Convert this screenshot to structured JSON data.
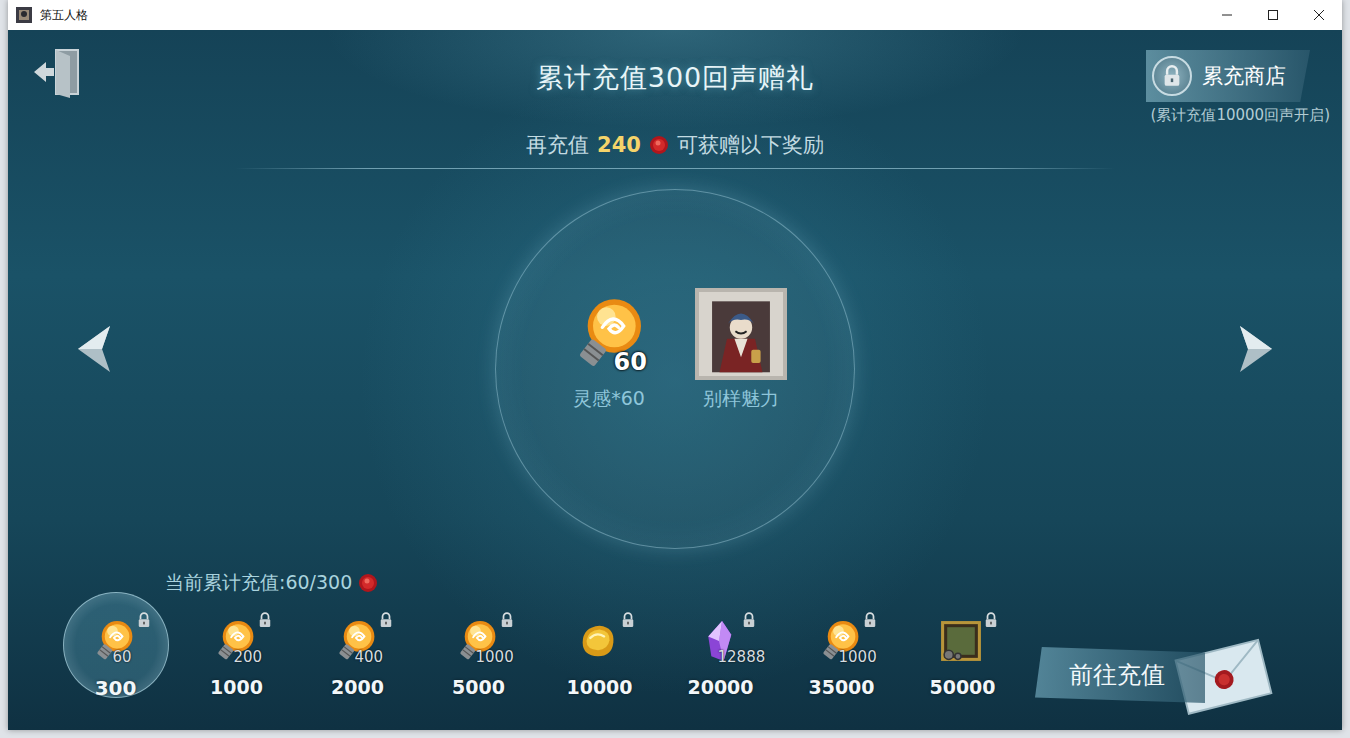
{
  "window": {
    "title": "第五人格"
  },
  "header": {
    "title": "累计充值300回声赠礼",
    "shop_button": {
      "label": "累充商店",
      "locked": true,
      "note": "(累计充值10000回声开启)"
    }
  },
  "subtitle": {
    "prefix": "再充值",
    "amount": "240",
    "suffix": "可获赠以下奖励"
  },
  "rewards": [
    {
      "label": "灵感*60",
      "count": "60",
      "kind": "inspiration"
    },
    {
      "label": "别样魅力",
      "count": "",
      "kind": "portrait"
    }
  ],
  "progress": {
    "label": "当前累计充值:60/300"
  },
  "tiers": [
    {
      "threshold": "300",
      "count": "60",
      "kind": "inspiration",
      "locked": true,
      "selected": true
    },
    {
      "threshold": "1000",
      "count": "200",
      "kind": "inspiration",
      "locked": true,
      "selected": false
    },
    {
      "threshold": "2000",
      "count": "400",
      "kind": "inspiration",
      "locked": true,
      "selected": false
    },
    {
      "threshold": "5000",
      "count": "1000",
      "kind": "inspiration",
      "locked": true,
      "selected": false
    },
    {
      "threshold": "10000",
      "count": "",
      "kind": "gold",
      "locked": true,
      "selected": false
    },
    {
      "threshold": "20000",
      "count": "12888",
      "kind": "crystal",
      "locked": true,
      "selected": false
    },
    {
      "threshold": "35000",
      "count": "1000",
      "kind": "inspiration",
      "locked": true,
      "selected": false
    },
    {
      "threshold": "50000",
      "count": "",
      "kind": "frame",
      "locked": true,
      "selected": false
    }
  ],
  "recharge_button": {
    "label": "前往充值"
  }
}
